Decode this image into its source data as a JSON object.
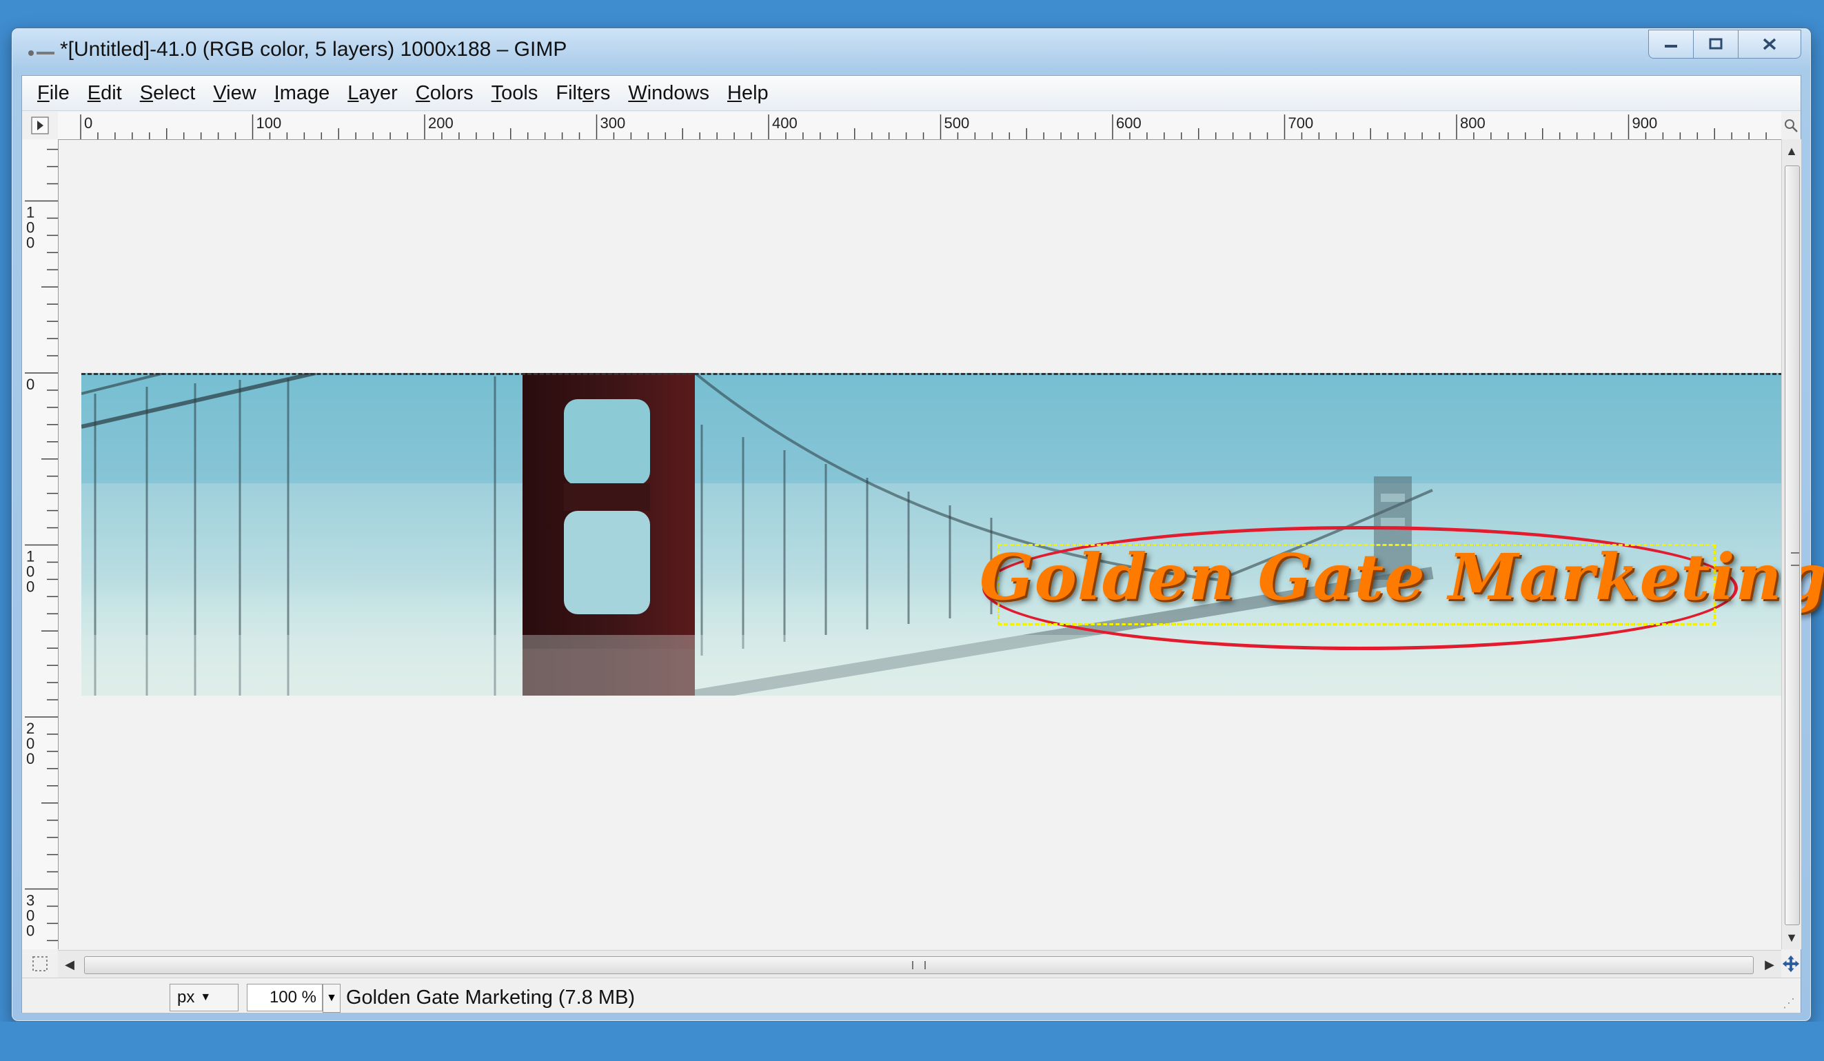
{
  "window": {
    "title": "*[Untitled]-41.0 (RGB color, 5 layers) 1000x188 – GIMP",
    "controls": {
      "minimize_icon": "minimize-icon",
      "maximize_icon": "maximize-icon",
      "close_icon": "close-icon"
    }
  },
  "menu": [
    {
      "pre": "",
      "u": "F",
      "post": "ile"
    },
    {
      "pre": "",
      "u": "E",
      "post": "dit"
    },
    {
      "pre": "",
      "u": "S",
      "post": "elect"
    },
    {
      "pre": "",
      "u": "V",
      "post": "iew"
    },
    {
      "pre": "",
      "u": "I",
      "post": "mage"
    },
    {
      "pre": "",
      "u": "L",
      "post": "ayer"
    },
    {
      "pre": "",
      "u": "C",
      "post": "olors"
    },
    {
      "pre": "",
      "u": "T",
      "post": "ools"
    },
    {
      "pre": "Filt",
      "u": "e",
      "post": "rs"
    },
    {
      "pre": "",
      "u": "W",
      "post": "indows"
    },
    {
      "pre": "",
      "u": "H",
      "post": "elp"
    }
  ],
  "rulers": {
    "horizontal_labels": [
      "0",
      "100",
      "200",
      "300",
      "400",
      "500",
      "600",
      "700",
      "800",
      "900"
    ],
    "vertical_labels": [
      "100",
      "0",
      "100",
      "200",
      "300"
    ]
  },
  "image": {
    "banner_text": "Golden Gate Marketing",
    "colors": {
      "text": "#ff7b00",
      "annotation": "#e31b2e",
      "sky": "#9fd0dc",
      "tower": "#3a1416"
    }
  },
  "statusbar": {
    "unit": "px",
    "zoom": "100 %",
    "status": "Golden Gate Marketing (7.8 MB)"
  }
}
